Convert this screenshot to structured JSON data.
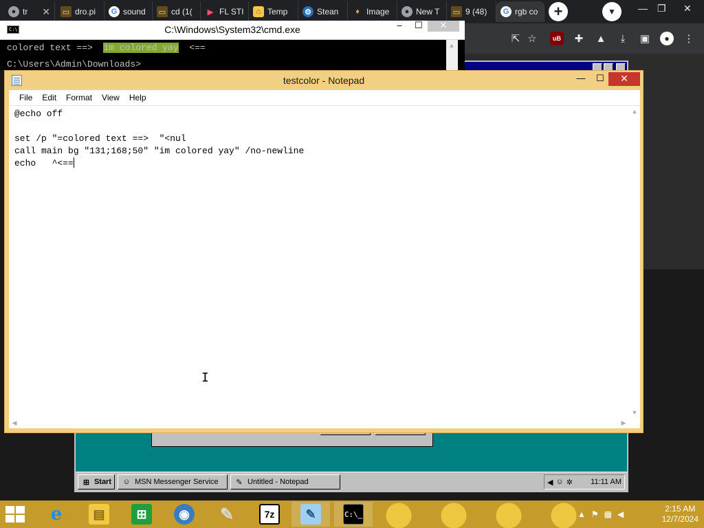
{
  "browser": {
    "tabs": [
      {
        "label": "tr",
        "icon": "chrome-icon"
      },
      {
        "label": "dro.pi",
        "icon": "folder-icon"
      },
      {
        "label": "sound",
        "icon": "google-icon"
      },
      {
        "label": "cd (1(",
        "icon": "folder-icon"
      },
      {
        "label": "FL STI",
        "icon": "play-icon"
      },
      {
        "label": "Temp",
        "icon": "home-icon"
      },
      {
        "label": "Stean",
        "icon": "steam-icon"
      },
      {
        "label": "Image",
        "icon": "flame-icon"
      },
      {
        "label": "New T",
        "icon": "chrome-icon"
      },
      {
        "label": "9 (48)",
        "icon": "folder-icon"
      },
      {
        "label": "rgb co",
        "icon": "google-icon"
      }
    ]
  },
  "cmd": {
    "title": "C:\\Windows\\System32\\cmd.exe",
    "line1_prefix": "colored text ==>  ",
    "line1_highlight": "im colored yay",
    "line1_suffix": "  <==",
    "line2": "C:\\Users\\Admin\\Downloads>",
    "highlight_color": "#83a832"
  },
  "notepad": {
    "title": "testcolor - Notepad",
    "menu": [
      "File",
      "Edit",
      "Format",
      "View",
      "Help"
    ],
    "lines": [
      "@echo off",
      "",
      "set /p \"=colored text ==>  \"<nul",
      "call main bg \"131;168;50\" \"im colored yay\" /no-newline",
      "echo   ^<=="
    ]
  },
  "vm": {
    "start_label": "Start",
    "tasks": [
      "MSN Messenger Service",
      "Untitled - Notepad"
    ],
    "clock": "11:11 AM"
  },
  "host": {
    "time": "2:15 AM",
    "date": "12/7/2024",
    "taskbar_icons": [
      "internet-explorer-icon",
      "file-explorer-icon",
      "store-icon",
      "globe-icon",
      "paint-icon",
      "7zip-icon",
      "notepad-icon",
      "cmd-icon"
    ]
  }
}
